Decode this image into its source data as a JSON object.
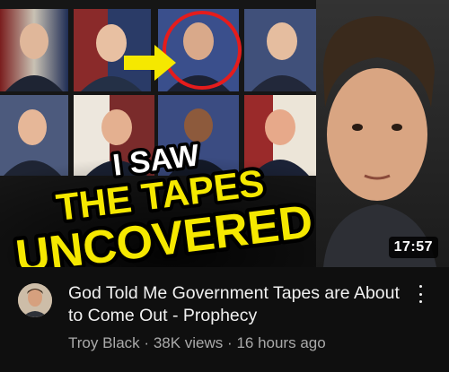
{
  "video": {
    "thumbnail": {
      "line1": "I SAW",
      "line2": "THE TAPES",
      "line3": "UNCOVERED",
      "duration": "17:57",
      "colors": {
        "line1": "#ffffff",
        "line2": "#f5e800",
        "line3": "#f5e800",
        "highlight": "#e51c1c",
        "arrow": "#f5e800"
      }
    },
    "title": "God Told Me Government Tapes are About to Come Out - Prophecy",
    "channel": "Troy Black",
    "views": "38K views",
    "age": "16 hours ago",
    "separator": "·"
  }
}
